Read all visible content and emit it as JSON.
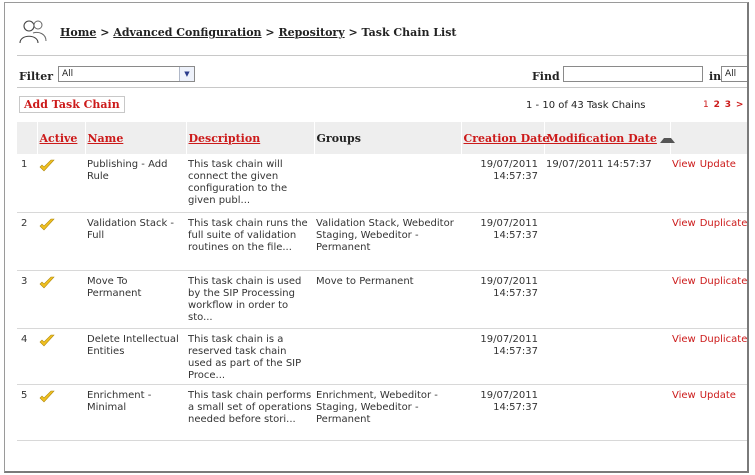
{
  "breadcrumb": {
    "items": [
      "Home",
      "Advanced Configuration",
      "Repository"
    ],
    "separator": ">",
    "current": "Task Chain List"
  },
  "filter": {
    "label": "Filter",
    "value": "All"
  },
  "find": {
    "label": "Find",
    "value": "",
    "in_label": "in",
    "in_value": "All"
  },
  "add_button": "Add Task Chain",
  "count_text": "1 - 10 of 43 Task Chains",
  "pager": {
    "current": "1",
    "pages": [
      "2",
      "3"
    ],
    "next": ">"
  },
  "columns": {
    "active": "Active",
    "name": "Name",
    "description": "Description",
    "groups": "Groups",
    "creation": "Creation Date",
    "modification": "Modification Date"
  },
  "rows": [
    {
      "num": "1",
      "name": "Publishing - Add Rule",
      "description": "This task chain will connect the given configuration to the given publ...",
      "groups": "",
      "created": "19/07/2011 14:57:37",
      "modified": "19/07/2011 14:57:37",
      "actions": [
        "View",
        "Update"
      ]
    },
    {
      "num": "2",
      "name": "Validation Stack - Full",
      "description": "This task chain runs the full suite of validation routines on the file...",
      "groups": "Validation Stack, Webeditor Staging, Webeditor - Permanent",
      "created": "19/07/2011 14:57:37",
      "modified": "",
      "actions": [
        "View",
        "Duplicate"
      ]
    },
    {
      "num": "3",
      "name": "Move To Permanent",
      "description": "This task chain is used by the SIP Processing workflow in order to sto...",
      "groups": "Move to Permanent",
      "created": "19/07/2011 14:57:37",
      "modified": "",
      "actions": [
        "View",
        "Duplicate"
      ]
    },
    {
      "num": "4",
      "name": "Delete Intellectual Entities",
      "description": "This task chain is a reserved task chain used as part of the SIP Proce...",
      "groups": "",
      "created": "19/07/2011 14:57:37",
      "modified": "",
      "actions": [
        "View",
        "Duplicate"
      ]
    },
    {
      "num": "5",
      "name": "Enrichment - Minimal",
      "description": "This task chain performs a small set of operations needed before stori...",
      "groups": "Enrichment, Webeditor - Staging, Webeditor - Permanent",
      "created": "19/07/2011 14:57:37",
      "modified": "",
      "actions": [
        "View",
        "Update"
      ]
    }
  ],
  "icons": {
    "breadcrumb": "users-icon",
    "active": "check-icon",
    "sort": "sort-ascending-icon"
  },
  "colors": {
    "link_red": "#cc1a1a",
    "check_yellow": "#f0c020",
    "header_bg": "#eeeeee"
  }
}
